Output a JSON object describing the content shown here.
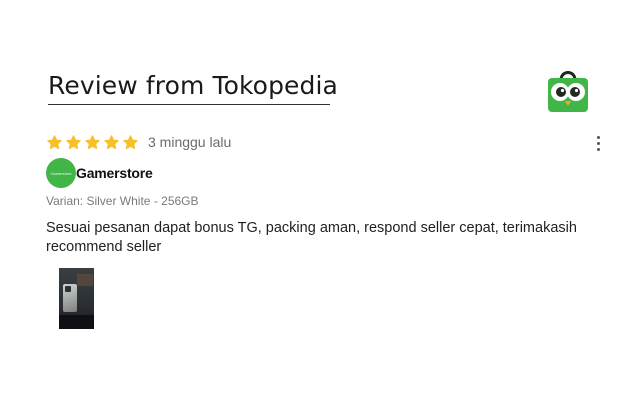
{
  "heading": "Review from Tokopedia",
  "logo": {
    "icon": "tokopedia-owl-bag-icon",
    "color": "#42b549"
  },
  "rating": {
    "stars": 5,
    "max_stars": 5,
    "star_color": "#f7c02b",
    "time_ago": "3 minggu lalu"
  },
  "reviewer": {
    "avatar_text": "Gamerstore",
    "name": "Gamerstore"
  },
  "variant": "Varian: Silver White - 256GB",
  "review_text": "Sesuai pesanan dapat bonus TG, packing aman, respond seller cepat, terimakasih recommend seller",
  "more_icon": "more-vertical-icon"
}
